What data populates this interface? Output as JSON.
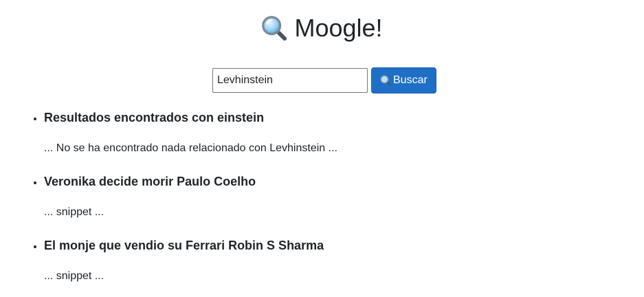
{
  "header": {
    "title": "Moogle!",
    "icon": "magnifier-icon"
  },
  "search": {
    "value": "Levhinstein",
    "placeholder": "",
    "button_label": "Buscar",
    "button_icon": "magnifier-icon"
  },
  "colors": {
    "button_bg": "#1f6fc7",
    "text": "#212529"
  },
  "results": [
    {
      "title": "Resultados encontrados con einstein",
      "snippet": "... No se ha encontrado nada relacionado con Levhinstein ..."
    },
    {
      "title": "Veronika decide morir Paulo Coelho",
      "snippet": "... snippet ..."
    },
    {
      "title": "El monje que vendio su Ferrari Robin S Sharma",
      "snippet": "... snippet ..."
    }
  ]
}
